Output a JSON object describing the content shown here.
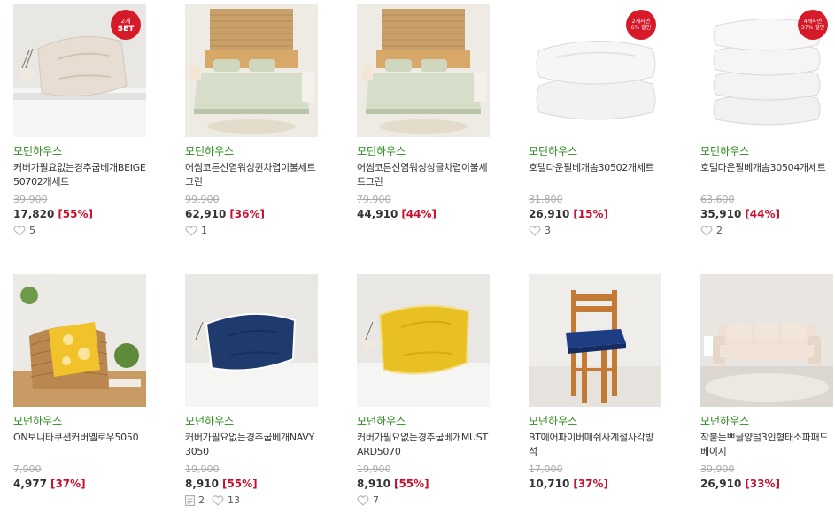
{
  "products": [
    {
      "brand": "모던하우스",
      "name": "커버가필요없는경추굽베개BEIGE50702개세트",
      "original_price": "39,900",
      "price": "17,820",
      "discount": "[55%]",
      "likes": "5",
      "badge_top": "2개",
      "badge_bottom": "SET"
    },
    {
      "brand": "모던하우스",
      "name": "어썸코튼선염워싱퀸차렵이불세트그린",
      "original_price": "99,900",
      "price": "62,910",
      "discount": "[36%]",
      "likes": "1"
    },
    {
      "brand": "모던하우스",
      "name": "어썸코튼선염워싱싱글차렵이불세트그린",
      "original_price": "79,900",
      "price": "44,910",
      "discount": "[44%]"
    },
    {
      "brand": "모던하우스",
      "name": "호텔다운필베개솜30502개세트",
      "original_price": "31,800",
      "price": "26,910",
      "discount": "[15%]",
      "likes": "3",
      "badge_top": "2개사면",
      "badge_bottom": "6% 할인"
    },
    {
      "brand": "모던하우스",
      "name": "호텔다운필베개솜30504개세트",
      "original_price": "63,600",
      "price": "35,910",
      "discount": "[44%]",
      "likes": "2",
      "badge_top": "4개사면",
      "badge_bottom": "37% 할인"
    },
    {
      "brand": "모던하우스",
      "name": "ON보니타쿠션커버옐로우5050",
      "original_price": "7,900",
      "price": "4,977",
      "discount": "[37%]"
    },
    {
      "brand": "모던하우스",
      "name": "커버가필요없는경추굽베개NAVY3050",
      "original_price": "19,900",
      "price": "8,910",
      "discount": "[55%]",
      "reviews": "2",
      "likes": "13"
    },
    {
      "brand": "모던하우스",
      "name": "커버가필요없는경추굽베개MUSTARD5070",
      "original_price": "19,900",
      "price": "8,910",
      "discount": "[55%]",
      "likes": "7"
    },
    {
      "brand": "모던하우스",
      "name": "BT에어파이버매쉬사계절사각방석",
      "original_price": "17,000",
      "price": "10,710",
      "discount": "[37%]"
    },
    {
      "brand": "모던하우스",
      "name": "착붙는뽀글양털3인형태소파패드베이지",
      "original_price": "39,900",
      "price": "26,910",
      "discount": "[33%]"
    }
  ],
  "icons": {
    "like": "heart-icon",
    "review": "review-icon"
  },
  "colors": {
    "brand": "#2a8a1a",
    "discount": "#c8102e",
    "badge": "#d61a2a",
    "original_price": "#aaaaaa"
  }
}
